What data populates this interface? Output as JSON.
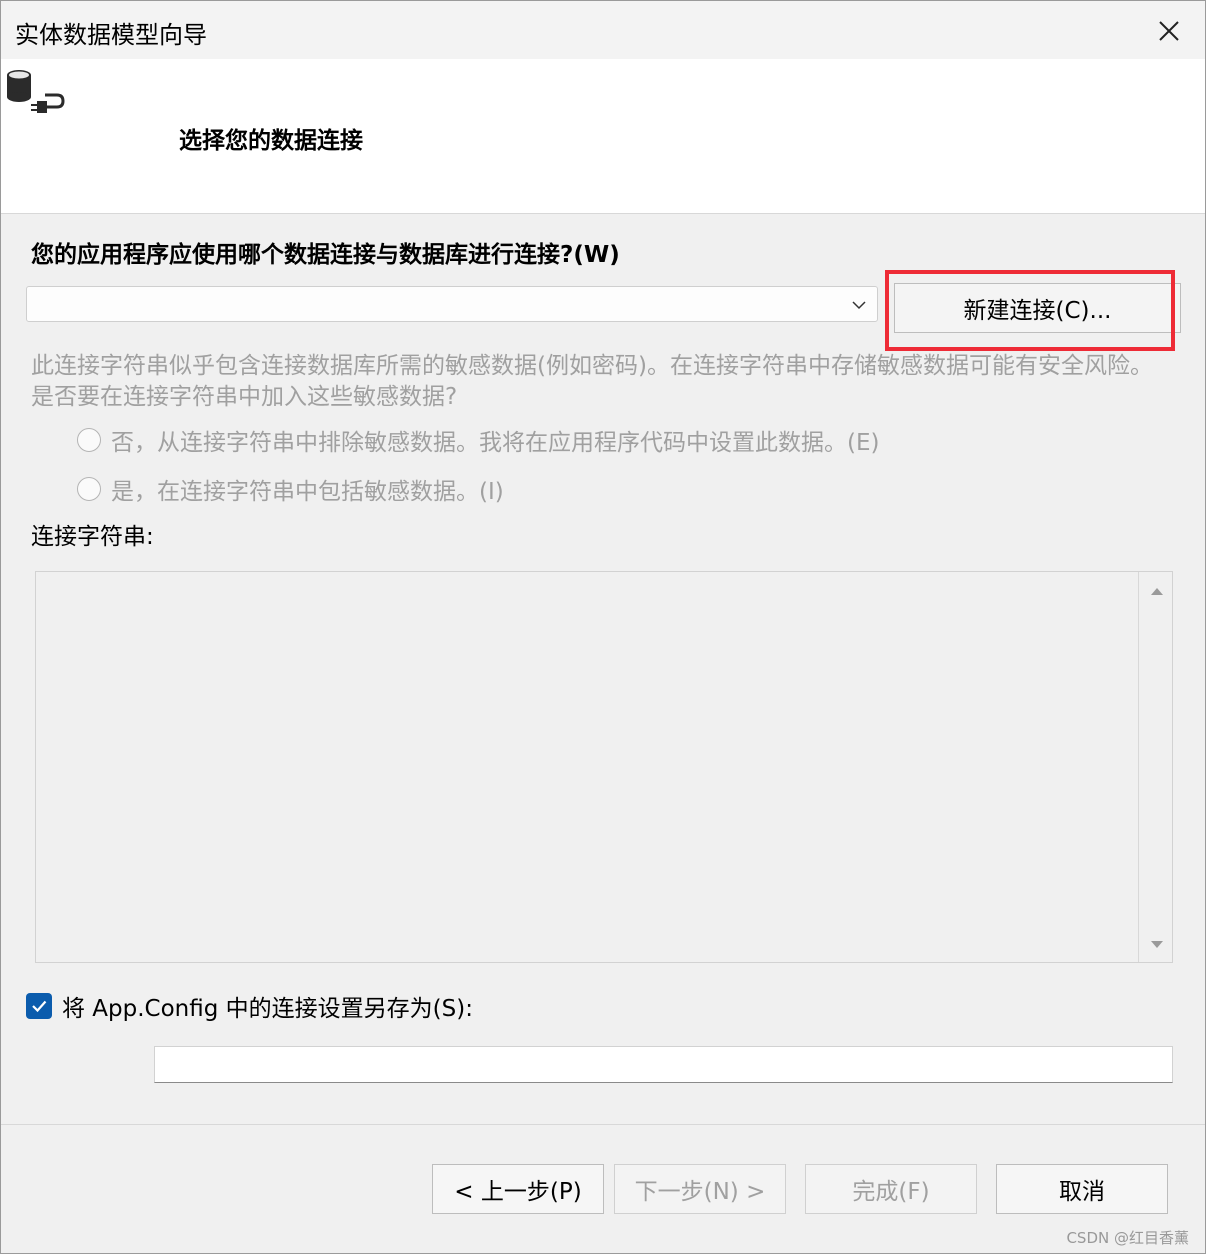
{
  "window": {
    "title": "实体数据模型向导"
  },
  "header": {
    "title": "选择您的数据连接",
    "icon": "database-plug-icon"
  },
  "connection": {
    "question": "您的应用程序应使用哪个数据连接与数据库进行连接?(W)",
    "selected_value": "",
    "new_connection_label": "新建连接(C)..."
  },
  "sensitive": {
    "warning": "此连接字符串似乎包含连接数据库所需的敏感数据(例如密码)。在连接字符串中存储敏感数据可能有安全风险。是否要在连接字符串中加入这些敏感数据?",
    "option_no": "否，从连接字符串中排除敏感数据。我将在应用程序代码中设置此数据。(E)",
    "option_yes": "是，在连接字符串中包括敏感数据。(I)"
  },
  "connection_string": {
    "label": "连接字符串:",
    "value": ""
  },
  "save": {
    "checked": true,
    "label": "将 App.Config 中的连接设置另存为(S):",
    "value": ""
  },
  "buttons": {
    "back": "< 上一步(P)",
    "next": "下一步(N) >",
    "finish": "完成(F)",
    "cancel": "取消"
  },
  "colors": {
    "highlight": "#ee2b36",
    "checkbox": "#0b5cad",
    "disabled_text": "#a0a0a0"
  },
  "watermark": "CSDN @红目香薰"
}
